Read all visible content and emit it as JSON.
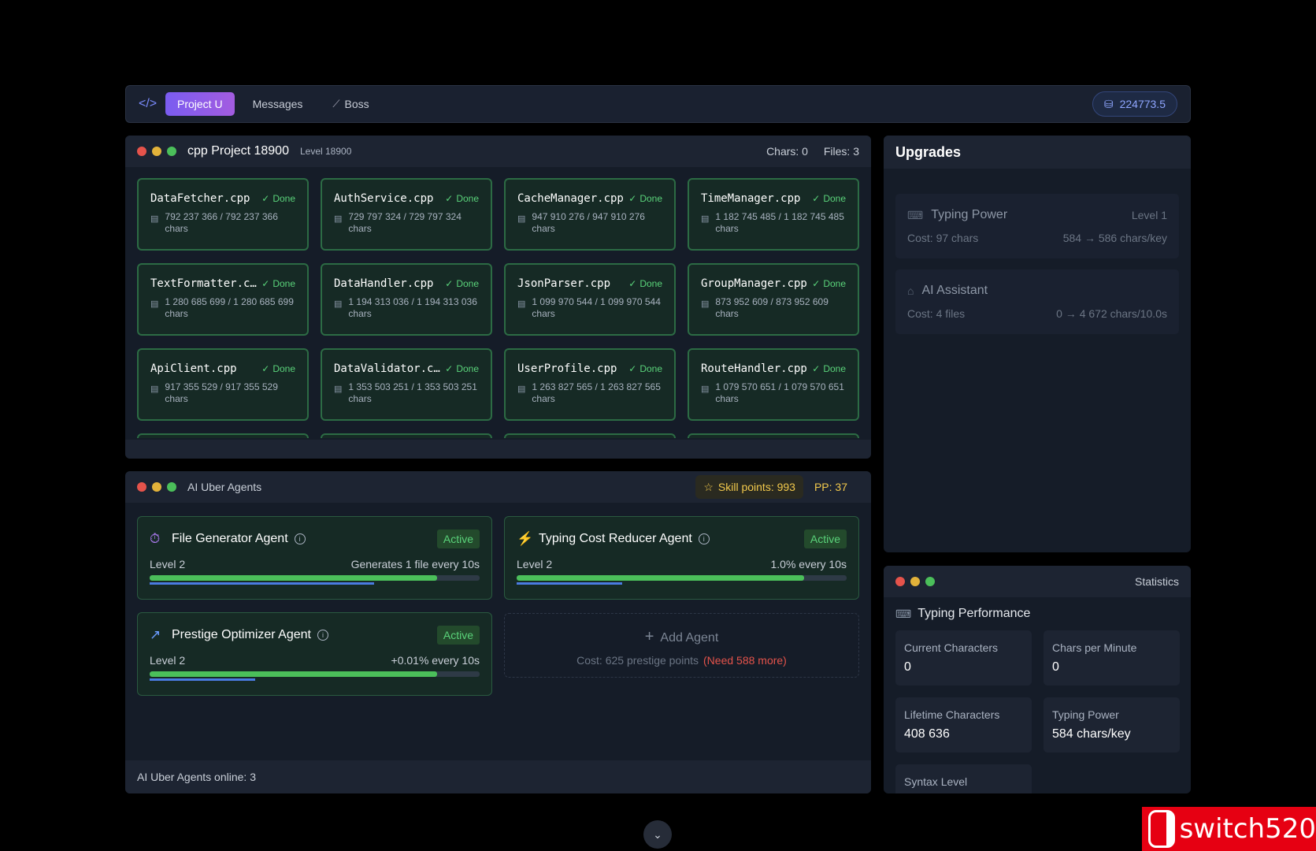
{
  "topbar": {
    "tabs": [
      {
        "label": "Project U",
        "active": true
      },
      {
        "label": "Messages",
        "active": false
      },
      {
        "label": "Boss",
        "active": false
      }
    ],
    "balance": "224773.5"
  },
  "project": {
    "title": "cpp Project 18900",
    "level": "Level 18900",
    "chars": "Chars: 0",
    "files_count": "Files: 3",
    "files": [
      {
        "name": "DataFetcher.cpp",
        "status": "Done",
        "progress": "792 237 366 / 792 237 366",
        "unit": "chars"
      },
      {
        "name": "AuthService.cpp",
        "status": "Done",
        "progress": "729 797 324 / 729 797 324",
        "unit": "chars"
      },
      {
        "name": "CacheManager.cpp",
        "status": "Done",
        "progress": "947 910 276 / 947 910 276",
        "unit": "chars"
      },
      {
        "name": "TimeManager.cpp",
        "status": "Done",
        "progress": "1 182 745 485 / 1 182 745 485",
        "unit": "chars"
      },
      {
        "name": "TextFormatter.c…",
        "status": "Done",
        "progress": "1 280 685 699 / 1 280 685 699",
        "unit": "chars"
      },
      {
        "name": "DataHandler.cpp",
        "status": "Done",
        "progress": "1 194 313 036 / 1 194 313 036",
        "unit": "chars"
      },
      {
        "name": "JsonParser.cpp",
        "status": "Done",
        "progress": "1 099 970 544 / 1 099 970 544",
        "unit": "chars"
      },
      {
        "name": "GroupManager.cpp",
        "status": "Done",
        "progress": "873 952 609 / 873 952 609",
        "unit": "chars"
      },
      {
        "name": "ApiClient.cpp",
        "status": "Done",
        "progress": "917 355 529 / 917 355 529",
        "unit": "chars"
      },
      {
        "name": "DataValidator.c…",
        "status": "Done",
        "progress": "1 353 503 251 / 1 353 503 251",
        "unit": "chars"
      },
      {
        "name": "UserProfile.cpp",
        "status": "Done",
        "progress": "1 263 827 565 / 1 263 827 565",
        "unit": "chars"
      },
      {
        "name": "RouteHandler.cpp",
        "status": "Done",
        "progress": "1 079 570 651 / 1 079 570 651",
        "unit": "chars"
      }
    ]
  },
  "agents": {
    "title": "AI Uber Agents",
    "skill_points": "Skill points: 993",
    "pp": "PP: 37",
    "list": [
      {
        "name": "File Generator Agent",
        "icon": "stopwatch-icon",
        "badge": "Active",
        "level": "Level 2",
        "effect": "Generates 1 file every 10s",
        "progress": 0.87,
        "sub_progress": 0.68
      },
      {
        "name": "Typing Cost Reducer Agent",
        "icon": "lightning-icon",
        "badge": "Active",
        "level": "Level 2",
        "effect": "1.0% every 10s",
        "progress": 0.87,
        "sub_progress": 0.32
      },
      {
        "name": "Prestige Optimizer Agent",
        "icon": "trending-up-icon",
        "badge": "Active",
        "level": "Level 2",
        "effect": "+0.01% every 10s",
        "progress": 0.87,
        "sub_progress": 0.32
      }
    ],
    "add_label": "Add Agent",
    "add_cost": "Cost: 625 prestige points",
    "add_need": "(Need 588 more)",
    "footer": "AI Uber Agents online: 3"
  },
  "upgrades": {
    "title": "Upgrades",
    "items": [
      {
        "name": "Typing Power",
        "level": "Level 1",
        "cost": "Cost: 97 chars",
        "effect": "584 → 586 chars/key",
        "icon": "keyboard-icon"
      },
      {
        "name": "AI Assistant",
        "level": "",
        "cost": "Cost: 4 files",
        "effect": "0 → 4 672 chars/10.0s",
        "icon": "robot-icon"
      }
    ]
  },
  "statistics": {
    "label": "Statistics",
    "section": "Typing Performance",
    "items": [
      {
        "label": "Current Characters",
        "value": "0"
      },
      {
        "label": "Chars per Minute",
        "value": "0"
      },
      {
        "label": "Lifetime Characters",
        "value": "408 636"
      },
      {
        "label": "Typing Power",
        "value": "584 chars/key"
      },
      {
        "label": "Syntax Level",
        "value": ""
      }
    ]
  },
  "watermark": "switch520",
  "colors": {
    "accent": "#7a5cf0",
    "done_green": "#5ad37a",
    "gold": "#f2c94c",
    "danger": "#e5534b"
  }
}
